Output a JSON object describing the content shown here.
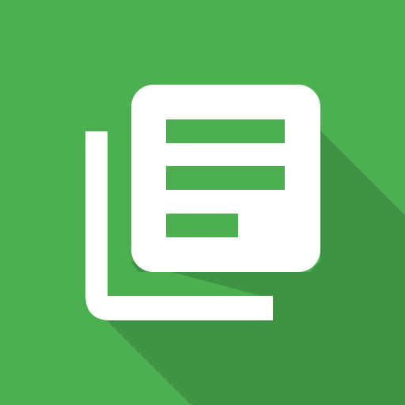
{
  "icon": {
    "name": "library-books-icon",
    "colors": {
      "background": "#4CAF50",
      "long_shadow": "#3E9443",
      "foreground": "#FFFFFF",
      "line_cutout": "#4CAF50"
    }
  }
}
